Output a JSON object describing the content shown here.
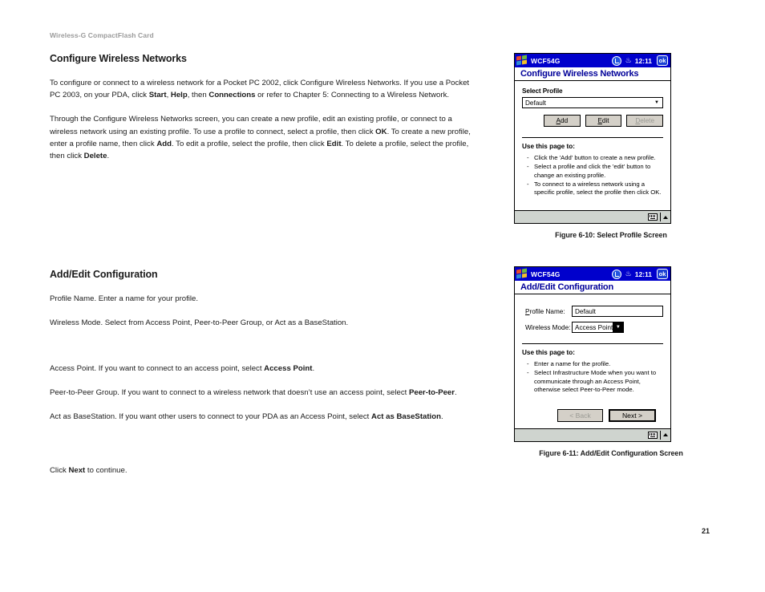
{
  "document": {
    "running_header": "Wireless-G CompactFlash Card",
    "page_number": "21"
  },
  "sections": [
    {
      "title": "Configure Wireless Networks",
      "paragraphs": [
        "To configure or connect to a wireless network for a Pocket PC 2002, click Configure Wireless Networks. If you use a Pocket PC 2003, on your PDA, click <b>Start</b>, <b>Help</b>, then <b>Connections</b> or refer to Chapter 5: Connecting to a Wireless Network.",
        "Through the Configure Wireless Networks screen, you can create a new profile, edit an existing profile, or connect to a wireless network using an existing profile. To use a profile to connect, select a profile, then click <b>OK</b>. To create a new profile, enter a profile name, then click <b>Add</b>. To edit a profile, select the profile, then click <b>Edit</b>. To delete a profile, select the profile, then click <b>Delete</b>."
      ]
    },
    {
      "title": "Add/Edit Configuration",
      "paragraphs": [
        "Profile Name. Enter a name for your profile.",
        "Wireless Mode. Select from Access Point, Peer-to-Peer Group, or Act as a BaseStation.",
        "Access Point. If you want to connect to an access point, select <b>Access Point</b>.",
        "Peer-to-Peer Group. If you want to connect to a wireless network that doesn’t use an access point, select <b>Peer-to-Peer</b>.",
        "Act as BaseStation. If you want other users to connect to your PDA as an Access Point, select <b>Act as BaseStation</b>.",
        "Click <b>Next</b> to continue."
      ]
    }
  ],
  "figures": [
    {
      "id": "figure-6-10",
      "caption": "Figure 6-10: Select Profile Screen",
      "titlebar": {
        "app_name": "WCF54G",
        "time": "12:11",
        "ok_label": "ok",
        "logo": "windows-logo-icon",
        "connectivity_icon": "connectivity-icon",
        "speaker_icon": "speaker-icon"
      },
      "screen_title": "Configure Wireless Networks",
      "select_profile": {
        "label": "Select Profile",
        "value": "Default",
        "options": [
          "Default"
        ]
      },
      "buttons": [
        {
          "label": "Add",
          "accesskey": "A",
          "enabled": true
        },
        {
          "label": "Edit",
          "accesskey": "E",
          "enabled": true
        },
        {
          "label": "Delete",
          "accesskey": "D",
          "enabled": false
        }
      ],
      "hints_title": "Use this page to:",
      "hints": [
        "Click the 'Add' button to create a new profile.",
        "Select a profile and click the 'edit' button to change an existing profile.",
        "To connect to a wireless network using a specific profile, select the profile then click OK."
      ],
      "bottom_bar": {
        "keyboard_icon": "keyboard-icon",
        "caret_icon": "caret-up-icon"
      }
    },
    {
      "id": "figure-6-11",
      "caption": "Figure 6-11: Add/Edit Configuration Screen",
      "titlebar": {
        "app_name": "WCF54G",
        "time": "12:11",
        "ok_label": "ok",
        "logo": "windows-logo-icon",
        "connectivity_icon": "connectivity-icon",
        "speaker_icon": "speaker-icon"
      },
      "screen_title": "Add/Edit Configuration",
      "fields": {
        "profile_name": {
          "label": "Profile Name:",
          "accesskey": "P",
          "value": "Default"
        },
        "wireless_mode": {
          "label": "Wireless Mode:",
          "value": "Access Point",
          "options": [
            "Access Point"
          ]
        }
      },
      "hints_title": "Use this page to:",
      "hints": [
        "Enter a name for the profile.",
        "Select Infrastructure Mode when you want to communicate through an Access Point, otherwise select Peer-to-Peer mode."
      ],
      "wizard_buttons": [
        {
          "label": "< Back",
          "enabled": false,
          "default": false
        },
        {
          "label": "Next >",
          "enabled": true,
          "default": true
        }
      ],
      "bottom_bar": {
        "keyboard_icon": "keyboard-icon",
        "caret_icon": "caret-up-icon"
      }
    }
  ],
  "colors": {
    "titlebar_blue": "#0000cc",
    "screen_title_blue": "#000099",
    "button_face": "#d4d0c8",
    "bottom_bar": "#cfd4cf",
    "header_gray": "#9b9b9b"
  }
}
